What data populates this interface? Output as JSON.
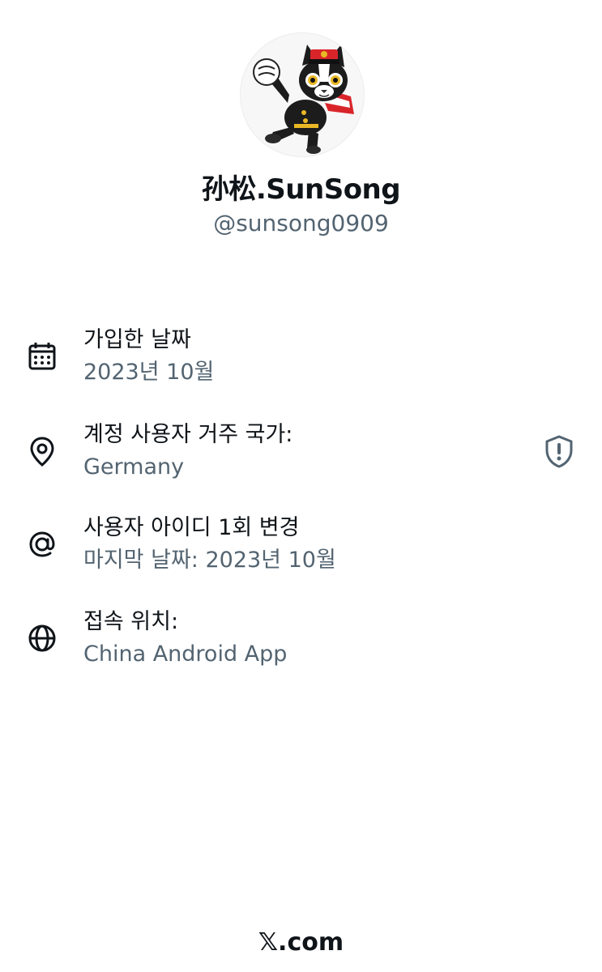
{
  "profile": {
    "avatar_icon": "cartoon-cat-mascot-avatar",
    "display_name": "孙松.SunSong",
    "handle": "@sunsong0909"
  },
  "about": {
    "joined": {
      "icon": "calendar-icon",
      "label": "가입한 날짜",
      "value": "2023년 10월"
    },
    "country": {
      "icon": "location-pin-icon",
      "label": "계정 사용자 거주 국가:",
      "value": "Germany",
      "badge_icon": "shield-alert-icon"
    },
    "username_changes": {
      "icon": "at-sign-icon",
      "label": "사용자 아이디 1회 변경",
      "value": "마지막 날짜: 2023년 10월"
    },
    "connected_via": {
      "icon": "globe-icon",
      "label": "접속 위치:",
      "value": "China Android App"
    }
  },
  "footer": {
    "brand": "𝕏.com"
  },
  "colors": {
    "primary_text": "#0f1419",
    "secondary_text": "#536471",
    "background": "#ffffff"
  }
}
